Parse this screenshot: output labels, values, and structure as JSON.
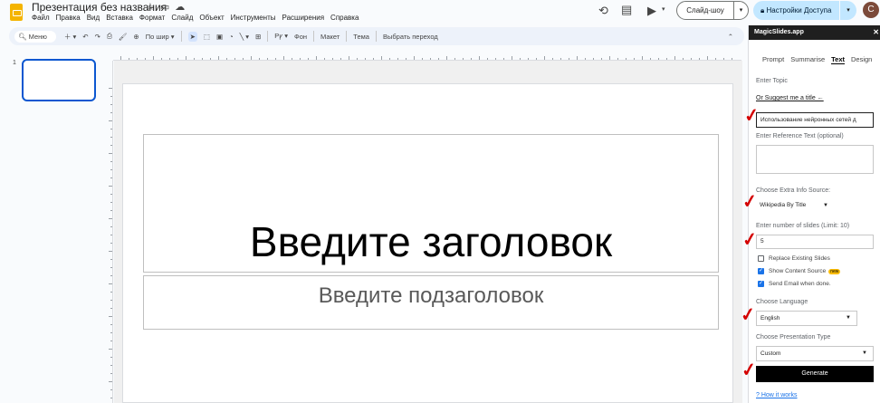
{
  "app": {
    "doc_title": "Презентация без названия",
    "menu": [
      "Файл",
      "Правка",
      "Вид",
      "Вставка",
      "Формат",
      "Слайд",
      "Объект",
      "Инструменты",
      "Расширения",
      "Справка"
    ],
    "slideshow_label": "Слайд-шоу",
    "share_label": "Настройки Доступа",
    "avatar_letter": "C"
  },
  "toolbar": {
    "search_placeholder": "Меню",
    "zoom_label": "По шир",
    "bg_label": "Фон",
    "layout_label": "Макет",
    "theme_label": "Тема",
    "transition_label": "Выбрать переход"
  },
  "thumbs": {
    "slide_number": "1"
  },
  "slide": {
    "title_placeholder": "Введите заголовок",
    "subtitle_placeholder": "Введите подзаголовок"
  },
  "panel": {
    "header": "MagicSlides.app",
    "tabs": [
      "Prompt",
      "Summarise",
      "Text",
      "Design"
    ],
    "active_tab": "Text",
    "enter_topic_label": "Enter Topic",
    "suggest_link": "Or Suggest me a title ←",
    "topic_value": "Использование нейронных сетей д",
    "ref_text_label": "Enter Reference Text (optional)",
    "extra_source_label": "Choose Extra Info Source:",
    "extra_source_value": "Wikipedia By Title",
    "slides_count_label": "Enter number of slides (Limit: 10)",
    "slides_count_value": "5",
    "replace_label": "Replace Existing Slides",
    "show_source_label": "Show Content Source",
    "new_badge": "new",
    "send_email_label": "Send Email when done.",
    "language_label": "Choose Language",
    "language_value": "English",
    "pres_type_label": "Choose Presentation Type",
    "pres_type_value": "Custom",
    "generate_label": "Generate",
    "how_link": "? How it works"
  }
}
